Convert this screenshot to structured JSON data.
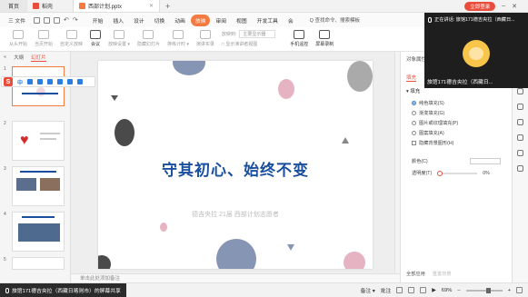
{
  "titlebar": {
    "home_tab": "首页",
    "doc_tab": "稻壳",
    "active_tab": "西部计划.pptx",
    "login_label": "立即登录"
  },
  "menu": {
    "file_label": "三 文件",
    "items": [
      "开始",
      "插入",
      "设计",
      "切换",
      "动画",
      "放映",
      "审阅",
      "视图",
      "开发工具",
      "会"
    ],
    "active_index": 5,
    "search_label": "Q 查找命令、搜索模板"
  },
  "ribbon": {
    "buttons": [
      {
        "label": "从头开始",
        "dark": false
      },
      {
        "label": "当页开始",
        "dark": false
      },
      {
        "label": "自定义放映",
        "dark": false
      },
      {
        "label": "会议",
        "dark": true
      },
      {
        "label": "放映设置 ▾",
        "dark": false
      },
      {
        "label": "隐藏幻灯片",
        "dark": false
      },
      {
        "label": "排练计时 ▾",
        "dark": false
      },
      {
        "label": "演讲实录",
        "dark": false
      }
    ],
    "col_label_1": "放映到:",
    "col_select_1": "主要显示器",
    "col_label_2": "□ 显示演讲者视图",
    "right_buttons": [
      {
        "label": "手机遥控"
      },
      {
        "label": "屏幕录制"
      }
    ]
  },
  "left_panel": {
    "tab_outline": "大纲",
    "tab_slides": "幻灯片",
    "float_tool_text": "中",
    "slide_numbers": [
      "1",
      "2",
      "3",
      "4",
      "5"
    ]
  },
  "slide": {
    "title": "守其初心、始终不变",
    "subtitle": "德吉央拉  21届 西部计划志愿者"
  },
  "notes_placeholder": "单击此处添加备注",
  "right_panel": {
    "header": "对象属性",
    "tab_fill": "填充",
    "section": "▾ 填充",
    "options": [
      {
        "label": "纯色填充(S)",
        "checked": true
      },
      {
        "label": "渐变填充(G)",
        "checked": false
      },
      {
        "label": "图片或纹理填充(P)",
        "checked": false
      },
      {
        "label": "图案填充(A)",
        "checked": false
      }
    ],
    "hide_bg": "隐藏背景图形(H)",
    "color_label": "颜色(C)",
    "transparency_label": "透明度(T)",
    "transparency_value": "0%",
    "apply_all": "全部应用",
    "reset_bg": "重置背景"
  },
  "meeting": {
    "speaking_label": "正在讲话: 旅馆171德吉央拉（西藏日...",
    "participant_name": "旅馆171德吉央拉（西藏日..."
  },
  "statusbar": {
    "share_label": "旅馆171德吉央拉（西藏日喀则市）的屏幕共享",
    "notes_btn": "备注 ▾",
    "comments_btn": "批注",
    "zoom": "69%"
  },
  "colors": {
    "accent": "#f37b41",
    "brand_red": "#e94e3c",
    "title_blue": "#1a4e9e"
  }
}
